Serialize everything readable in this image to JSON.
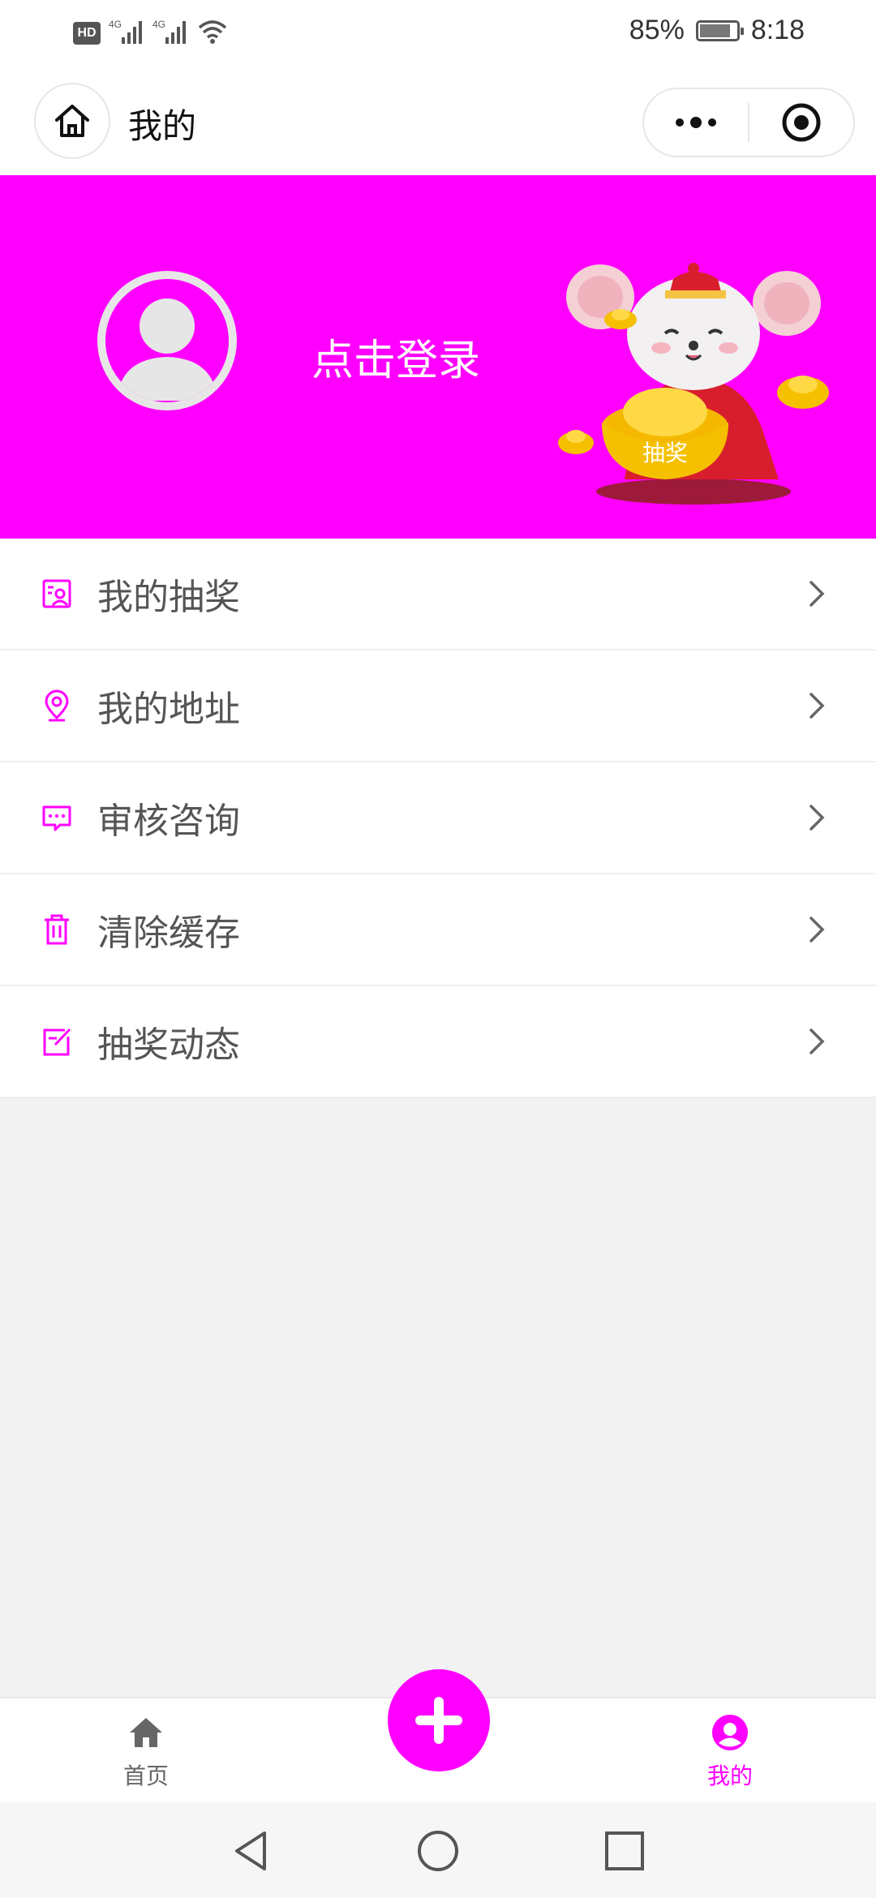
{
  "status_bar": {
    "hd_label": "HD",
    "network_1": "4G",
    "network_2": "4G",
    "battery": "85%",
    "battery_level": 0.85,
    "time": "8:18"
  },
  "nav": {
    "title": "我的",
    "home_icon": "home-icon",
    "more_icon": "more-dots-icon",
    "close_icon": "target-circle-icon"
  },
  "profile": {
    "login_text": "点击登录",
    "badge_text": "抽奖",
    "avatar_icon": "default-avatar-icon"
  },
  "menu": {
    "items": [
      {
        "label": "我的抽奖",
        "icon": "lottery-card-icon"
      },
      {
        "label": "我的地址",
        "icon": "location-pin-icon"
      },
      {
        "label": "审核咨询",
        "icon": "message-dots-icon"
      },
      {
        "label": "清除缓存",
        "icon": "trash-icon"
      },
      {
        "label": "抽奖动态",
        "icon": "edit-note-icon"
      }
    ]
  },
  "tabbar": {
    "home_label": "首页",
    "mine_label": "我的",
    "active_tab": "mine"
  },
  "colors": {
    "accent": "#ff00ff",
    "background": "#f2f2f2",
    "menu_text": "#555555"
  }
}
